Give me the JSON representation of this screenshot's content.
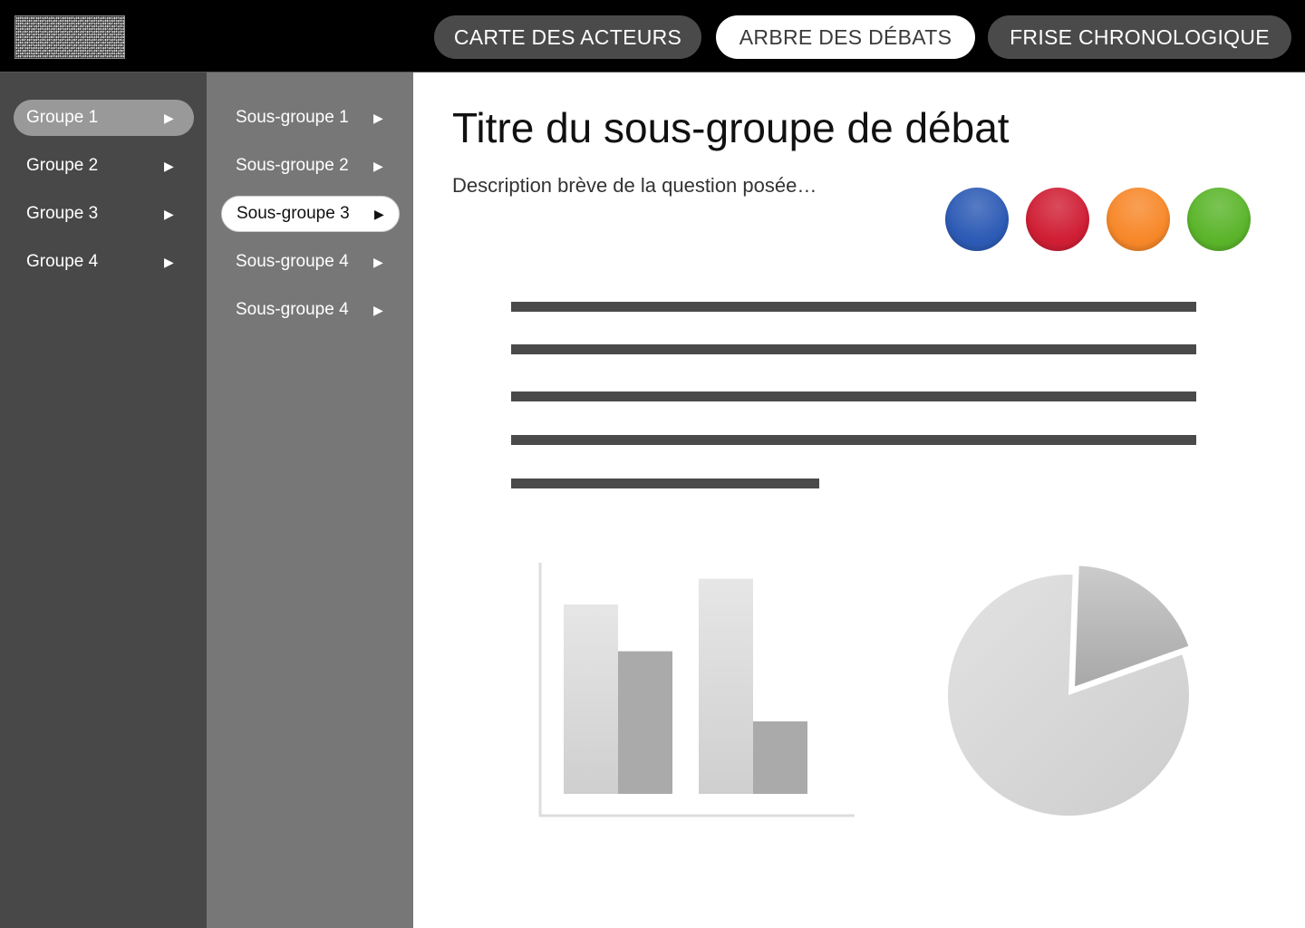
{
  "header": {
    "logo_alt": "logo",
    "tabs": [
      {
        "label": "CARTE DES ACTEURS",
        "active": false
      },
      {
        "label": "ARBRE DES DÉBATS",
        "active": true
      },
      {
        "label": "FRISE CHRONOLOGIQUE",
        "active": false
      }
    ]
  },
  "sidebar": {
    "groups": [
      {
        "label": "Groupe 1",
        "arrow": "▶",
        "selected": true
      },
      {
        "label": "Groupe 2",
        "arrow": "▶",
        "selected": false
      },
      {
        "label": "Groupe 3",
        "arrow": "▶",
        "selected": false
      },
      {
        "label": "Groupe 4",
        "arrow": "▶",
        "selected": false
      }
    ],
    "subgroups": [
      {
        "label": "Sous-groupe 1",
        "arrow": "▶",
        "selected": false
      },
      {
        "label": "Sous-groupe 2",
        "arrow": "▶",
        "selected": false
      },
      {
        "label": "Sous-groupe 3",
        "arrow": "▶",
        "selected": true
      },
      {
        "label": "Sous-groupe 4",
        "arrow": "▶",
        "selected": false
      },
      {
        "label": "Sous-groupe 4",
        "arrow": "▶",
        "selected": false
      }
    ]
  },
  "main": {
    "title": "Titre du sous-groupe de débat",
    "description": "Description brève de la question posée…",
    "color_options": [
      {
        "name": "blue",
        "color": "#2d5bb5"
      },
      {
        "name": "red",
        "color": "#d01f35"
      },
      {
        "name": "orange",
        "color": "#f7882a"
      },
      {
        "name": "green",
        "color": "#5bb52b"
      }
    ],
    "text_placeholder_lines": 5
  },
  "chart_data": [
    {
      "type": "bar",
      "title": "",
      "xlabel": "",
      "ylabel": "",
      "categories": [
        "",
        ""
      ],
      "series": [
        {
          "values": [
            81,
            92
          ],
          "color": "#d9d9d9"
        },
        {
          "values": [
            61,
            31
          ],
          "color": "#aaaaaa"
        }
      ],
      "ylim": [
        0,
        100
      ],
      "grid": false
    },
    {
      "type": "pie",
      "title": "",
      "values": [
        81,
        19
      ],
      "colors": [
        "#dadada",
        "#b8b8b8"
      ],
      "exploded": [
        false,
        true
      ]
    }
  ]
}
